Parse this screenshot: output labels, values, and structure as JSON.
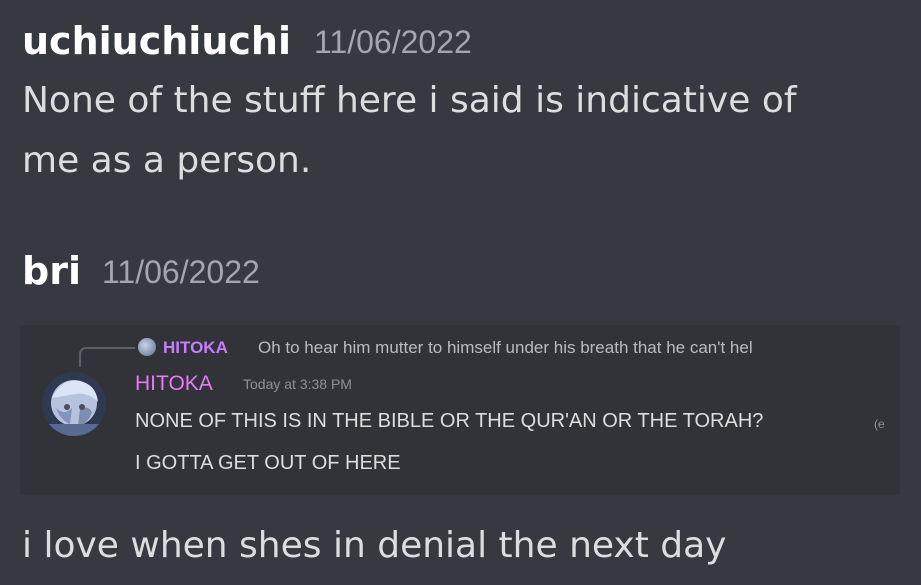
{
  "messages": [
    {
      "author": "uchiuchiuchi",
      "timestamp": "11/06/2022",
      "lines": [
        "None of the stuff here i said is indicative of",
        "me as a person."
      ]
    },
    {
      "author": "bri",
      "timestamp": "11/06/2022",
      "embedded_screenshot": {
        "reply": {
          "author": "HITOKA",
          "text": "Oh to hear him mutter to himself under his breath that he can't hel"
        },
        "message": {
          "author": "HITOKA",
          "timestamp": "Today at 3:38 PM",
          "lines": [
            "NONE OF THIS IS IN THE BIBLE OR THE QUR'AN OR THE TORAH?",
            "I GOTTA GET OUT OF HERE"
          ],
          "edited_marker": "(e"
        }
      },
      "text": "i love when shes in denial the next day"
    }
  ],
  "colors": {
    "background": "#36393f",
    "author": "#ffffff",
    "timestamp": "#a3a6aa",
    "text": "#dcddde",
    "hitoka": "#e879f9"
  }
}
